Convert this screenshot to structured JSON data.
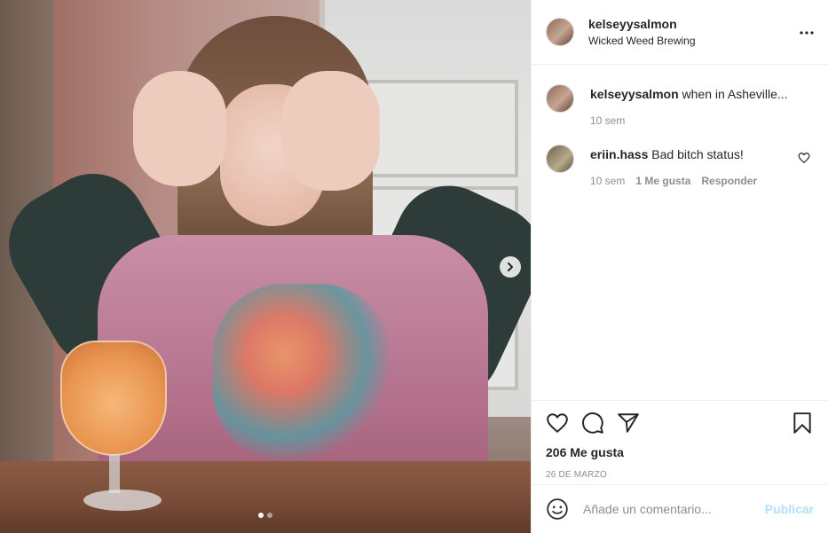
{
  "post": {
    "author": "kelseyysalmon",
    "location": "Wicked Weed Brewing",
    "more_icon": "more-horizontal-icon",
    "carousel": {
      "current_slide": 1,
      "total_slides": 2,
      "next_icon": "chevron-right-icon"
    }
  },
  "comments": [
    {
      "username": "kelseyysalmon",
      "text": "when in Asheville...",
      "time": "10 sem"
    },
    {
      "username": "eriin.hass",
      "text": "Bad bitch status!",
      "time": "10 sem",
      "likes": "1 Me gusta",
      "reply": "Responder",
      "heart_icon": "heart-outline-icon"
    }
  ],
  "actions": {
    "like_icon": "heart-outline-icon",
    "comment_icon": "comment-icon",
    "share_icon": "paper-plane-icon",
    "save_icon": "bookmark-icon",
    "likes": "206 Me gusta",
    "date": "26 DE MARZO"
  },
  "add_comment": {
    "emoji_icon": "smiley-icon",
    "placeholder": "Añade un comentario...",
    "publish_label": "Publicar",
    "publish_color": "#b2dffc"
  }
}
